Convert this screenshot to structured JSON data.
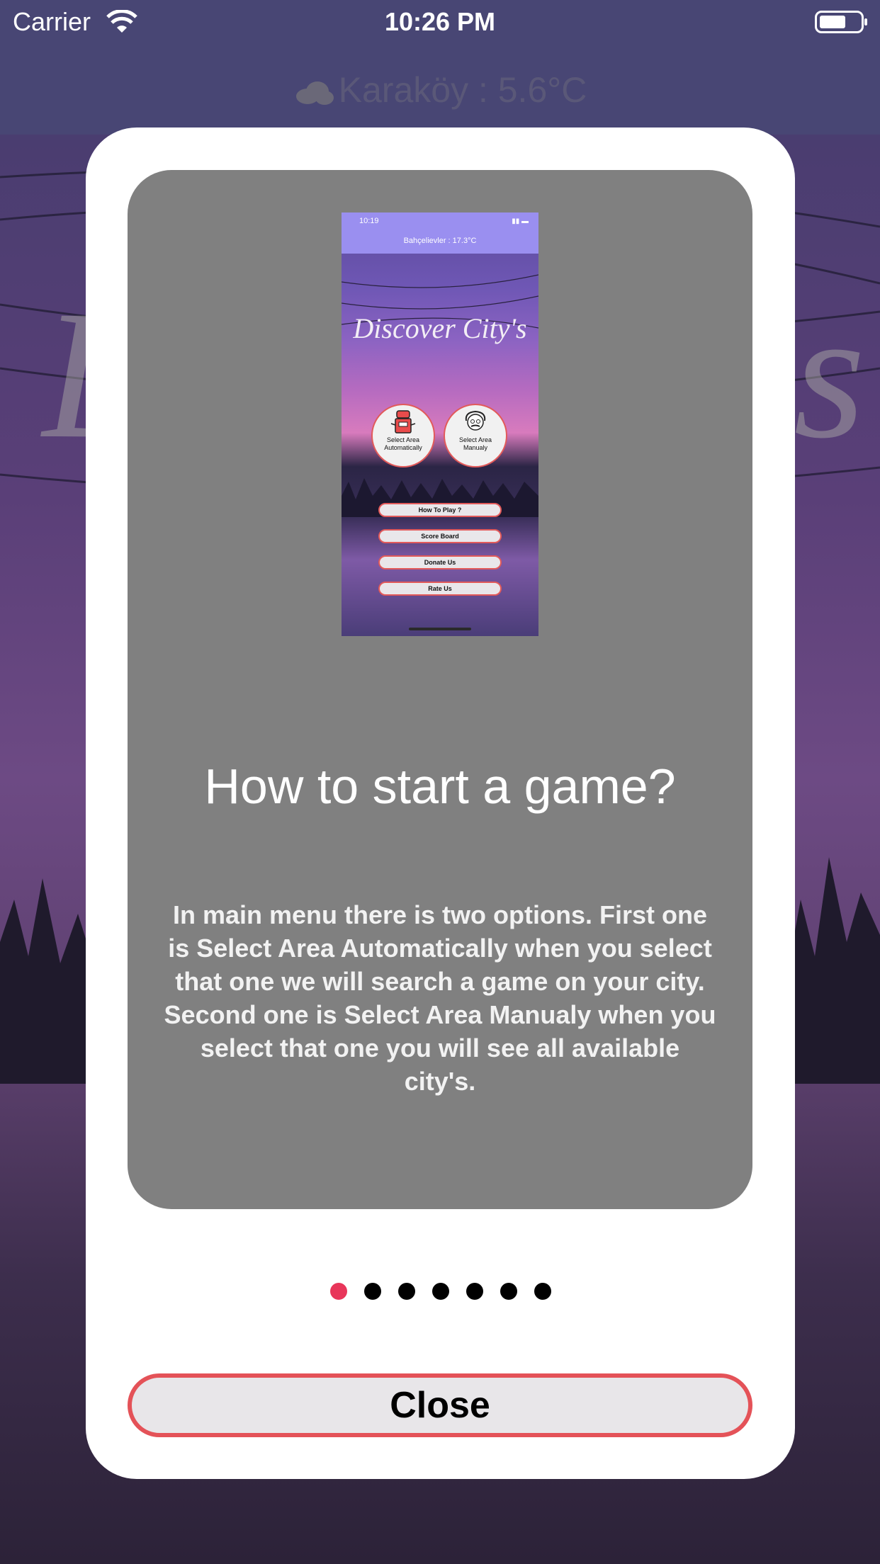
{
  "status_bar": {
    "carrier": "Carrier",
    "time": "10:26 PM",
    "icons": [
      "wifi-icon",
      "battery-icon"
    ]
  },
  "header": {
    "weather_text": "Karaköy : 5.6°C",
    "weather_icon": "cloud-icon"
  },
  "modal": {
    "preview": {
      "time": "10:19",
      "weather": "Bahçelievler : 17.3°C",
      "title": "Discover City's",
      "options": [
        {
          "label_line1": "Select Area",
          "label_line2": "Automatically",
          "icon": "robot-icon"
        },
        {
          "label_line1": "Select Area",
          "label_line2": "Manualy",
          "icon": "einstein-icon"
        }
      ],
      "menu": [
        "How To Play ?",
        "Score Board",
        "Donate Us",
        "Rate Us"
      ]
    },
    "title": "How to start a game?",
    "description": "In main menu there is two options. First one is Select Area Automatically when you select that one we will search a game on your city. Second one is Select Area Manualy when you select that one you will see all available city's.",
    "pager": {
      "total": 7,
      "current": 1
    },
    "close_label": "Close"
  },
  "colors": {
    "accent": "#e8365a",
    "button_border": "#e45258",
    "card_bg": "#808080",
    "header_bg": "#484674"
  }
}
